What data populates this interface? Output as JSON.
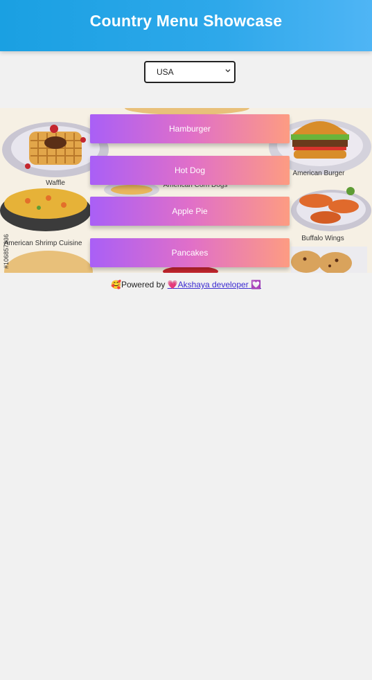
{
  "header": {
    "title": "Country Menu Showcase"
  },
  "country_select": {
    "selected": "USA",
    "options": [
      "USA"
    ]
  },
  "banner": {
    "labels": {
      "waffle": "Waffle",
      "american_burger": "American Burger",
      "corn_dogs": "American Corn Dogs",
      "shrimp": "American Shrimp Cuisine",
      "buffalo_wings": "Buffalo Wings",
      "stock_id": "#106857336"
    }
  },
  "menu": {
    "items": [
      {
        "label": "Hamburger"
      },
      {
        "label": "Hot Dog"
      },
      {
        "label": "Apple Pie"
      },
      {
        "label": "Pancakes"
      }
    ]
  },
  "footer": {
    "prefix_emoji": "🥰",
    "powered_by": "Powered by",
    "link_emoji": "💗",
    "link_text": "Akshaya developer",
    "suffix_emoji": "💟"
  },
  "colors": {
    "header_gradient": [
      "#1aa0e2",
      "#4fb5f5"
    ],
    "button_gradient": [
      "#a95ff6",
      "#e06fc9",
      "#fd9c82"
    ],
    "page_bg": "#f1f1f1"
  }
}
